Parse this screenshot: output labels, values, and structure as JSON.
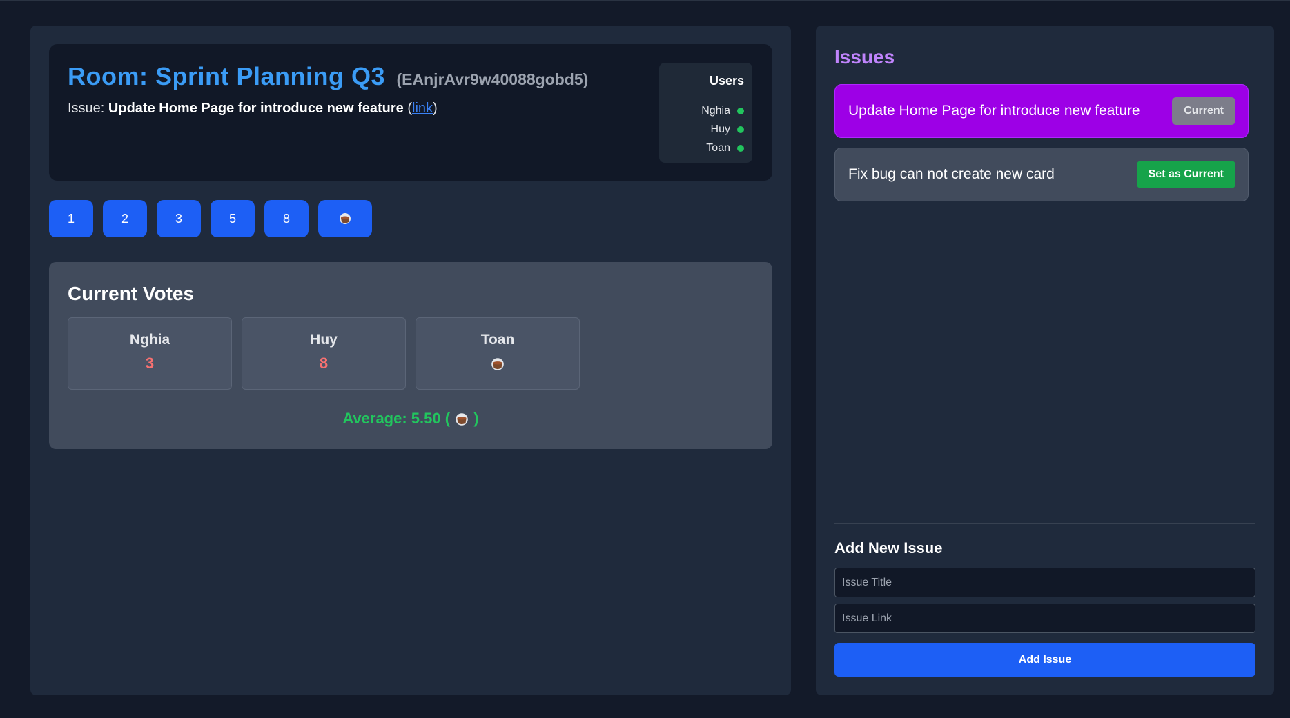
{
  "room": {
    "label": "Room: Sprint Planning Q3",
    "id": "(EAnjrAvr9w40088gobd5)",
    "issue_prefix": "Issue:",
    "issue_title": "Update Home Page for introduce new feature",
    "link_open": "(",
    "link_text": "link",
    "link_close": ")"
  },
  "users": {
    "title": "Users",
    "list": [
      {
        "name": "Nghia",
        "status": "online"
      },
      {
        "name": "Huy",
        "status": "online"
      },
      {
        "name": "Toan",
        "status": "online"
      }
    ]
  },
  "vote_options": [
    "1",
    "2",
    "3",
    "5",
    "8",
    "coffee-cup-icon"
  ],
  "current_votes": {
    "title": "Current Votes",
    "votes": [
      {
        "name": "Nghia",
        "value": "3"
      },
      {
        "name": "Huy",
        "value": "8"
      },
      {
        "name": "Toan",
        "value": "coffee-cup-icon"
      }
    ],
    "average_prefix": "Average: 5.50 (",
    "average_suffix": ")"
  },
  "issues": {
    "title": "Issues",
    "items": [
      {
        "title": "Update Home Page for introduce new feature",
        "button": "Current",
        "is_current": true
      },
      {
        "title": "Fix bug can not create new card",
        "button": "Set as Current",
        "is_current": false
      }
    ]
  },
  "add_issue": {
    "title": "Add New Issue",
    "title_placeholder": "Issue Title",
    "link_placeholder": "Issue Link",
    "button": "Add Issue"
  },
  "colors": {
    "accent_blue": "#1d5ff5",
    "room_title": "#3b9cf6",
    "issues_title": "#c084fc",
    "current_issue": "#9d00e6",
    "set_current": "#16a34a",
    "vote_value": "#f87171",
    "average": "#22c55e",
    "online": "#22c55e"
  }
}
